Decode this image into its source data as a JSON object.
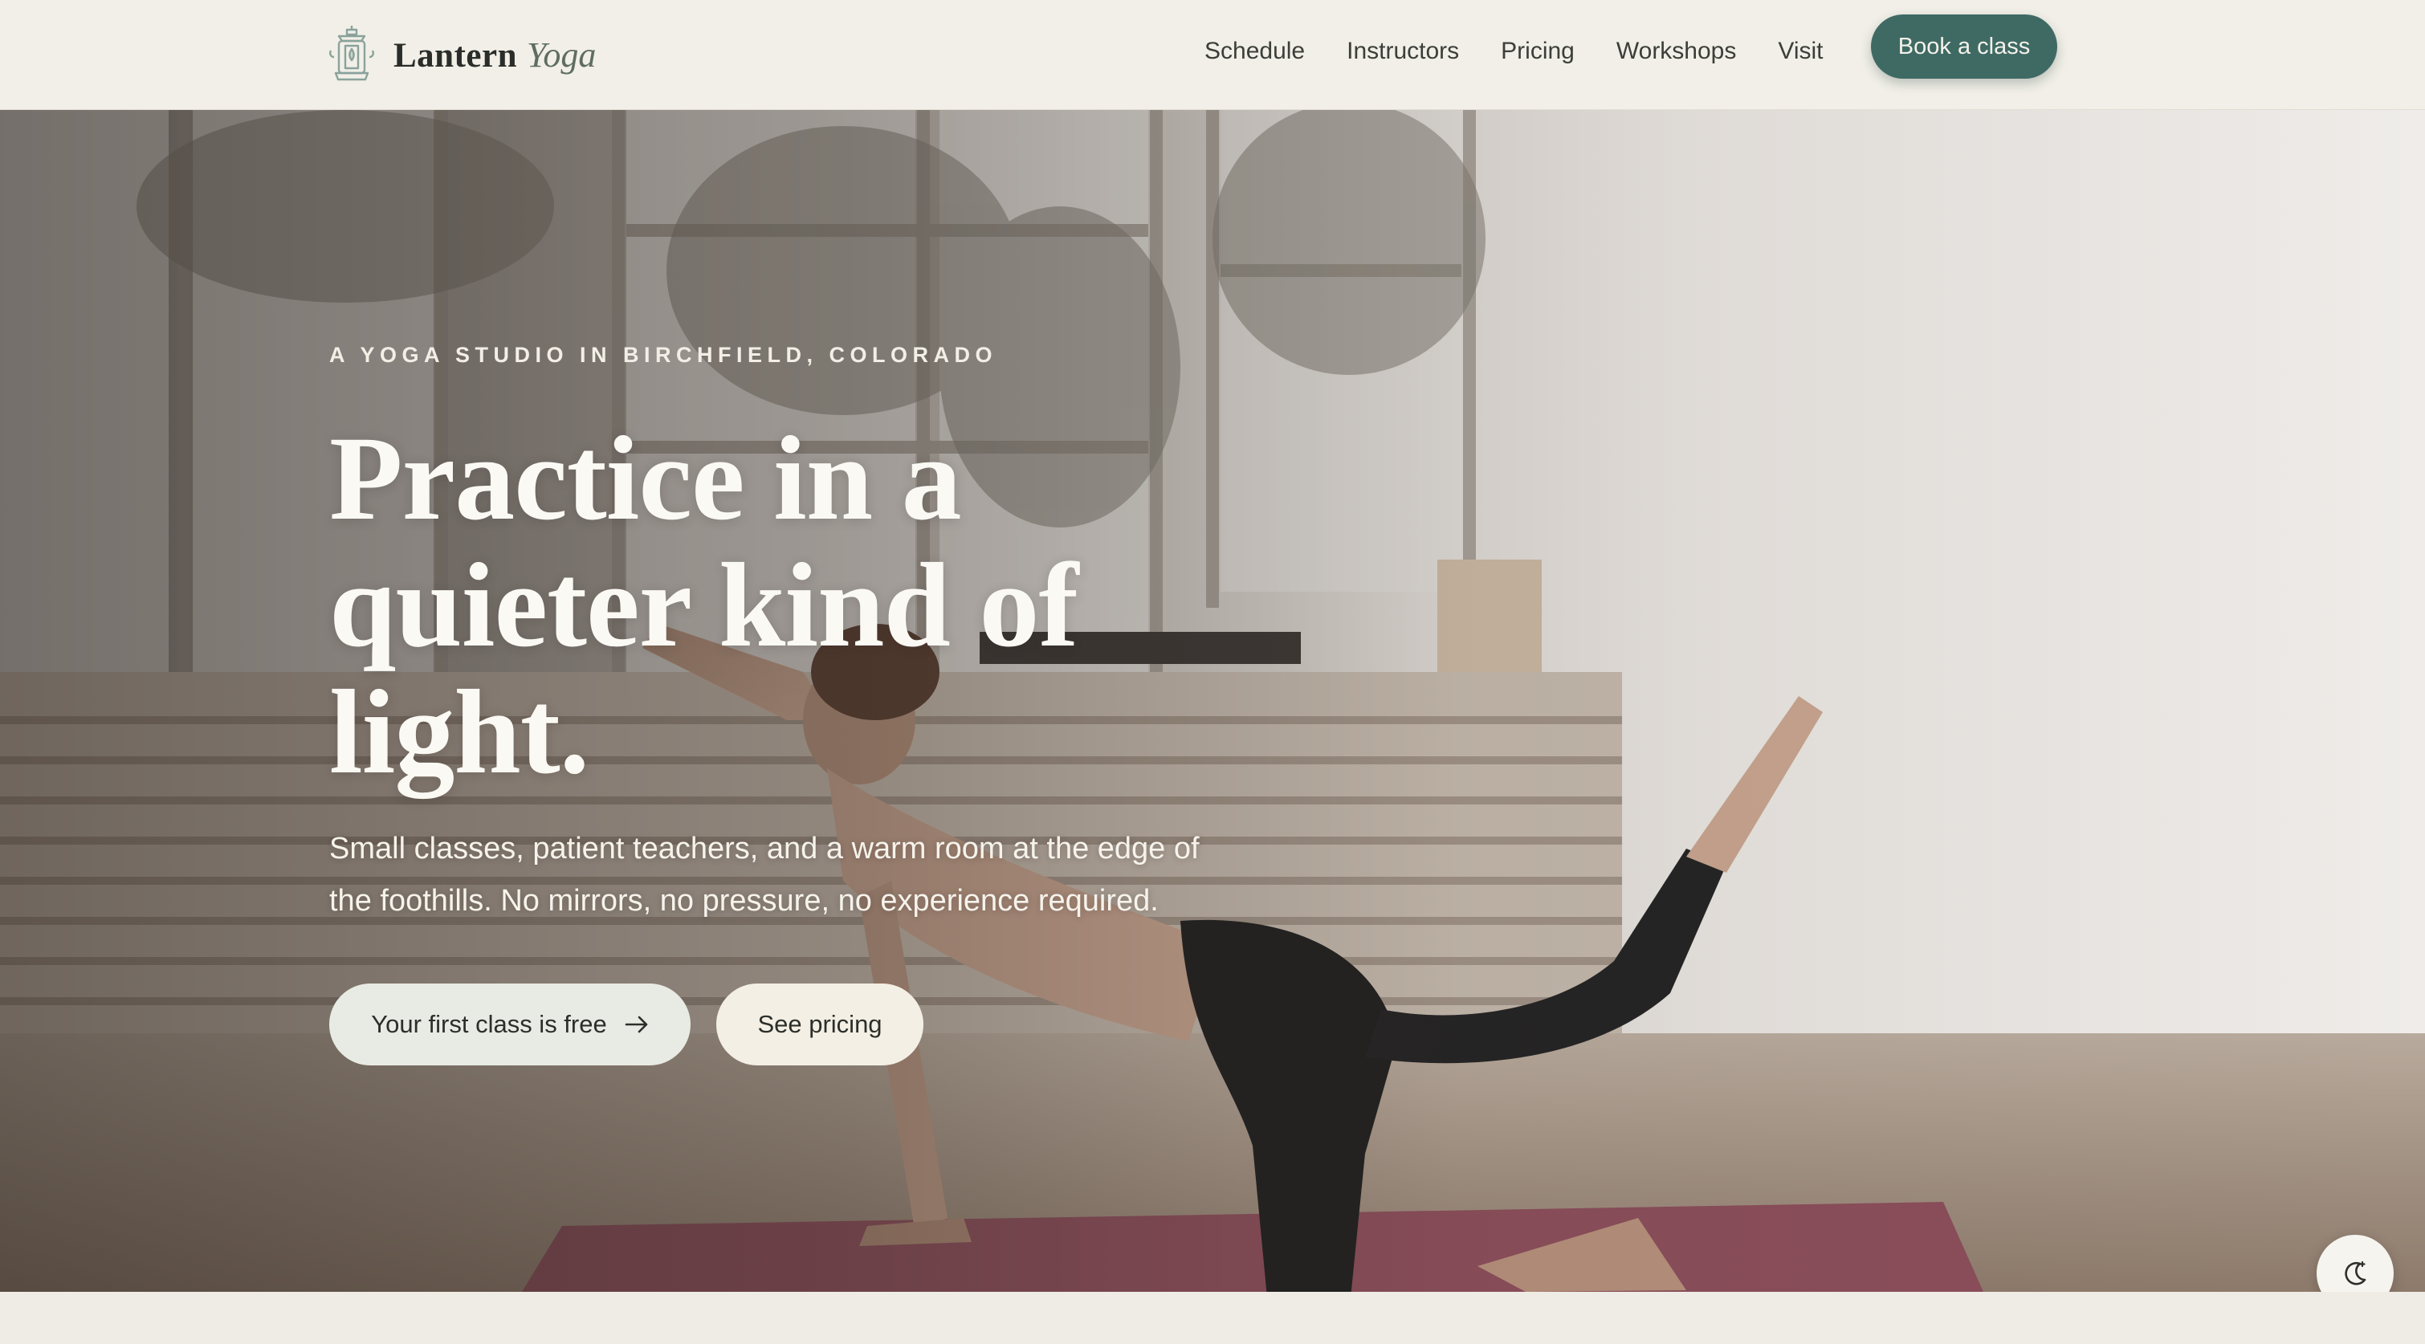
{
  "brand": {
    "name": "Lantern",
    "accent": "Yoga",
    "logo_icon": "lantern-icon"
  },
  "nav": {
    "items": [
      {
        "label": "Schedule"
      },
      {
        "label": "Instructors"
      },
      {
        "label": "Pricing"
      },
      {
        "label": "Workshops"
      },
      {
        "label": "Visit"
      }
    ],
    "cta_label": "Book a class"
  },
  "hero": {
    "eyebrow": "A YOGA STUDIO IN BIRCHFIELD, COLORADO",
    "headline": "Practice in a quieter kind of light.",
    "subtext": "Small classes, patient teachers, and a warm room at the edge of the foothills. No mirrors, no pressure, no experience required.",
    "primary_cta": "Your first class is free",
    "primary_cta_icon": "arrow-right-icon",
    "secondary_cta": "See pricing",
    "image_subject": "woman practicing yoga on a mat in a bright studio"
  },
  "theme_toggle": {
    "icon": "moon-icon"
  },
  "colors": {
    "accent": "#3f6a64",
    "header_bg": "#f1efe7",
    "page_bg": "#efede5",
    "text_dark": "#2d2f2b",
    "mat": "#8a4e5a"
  }
}
